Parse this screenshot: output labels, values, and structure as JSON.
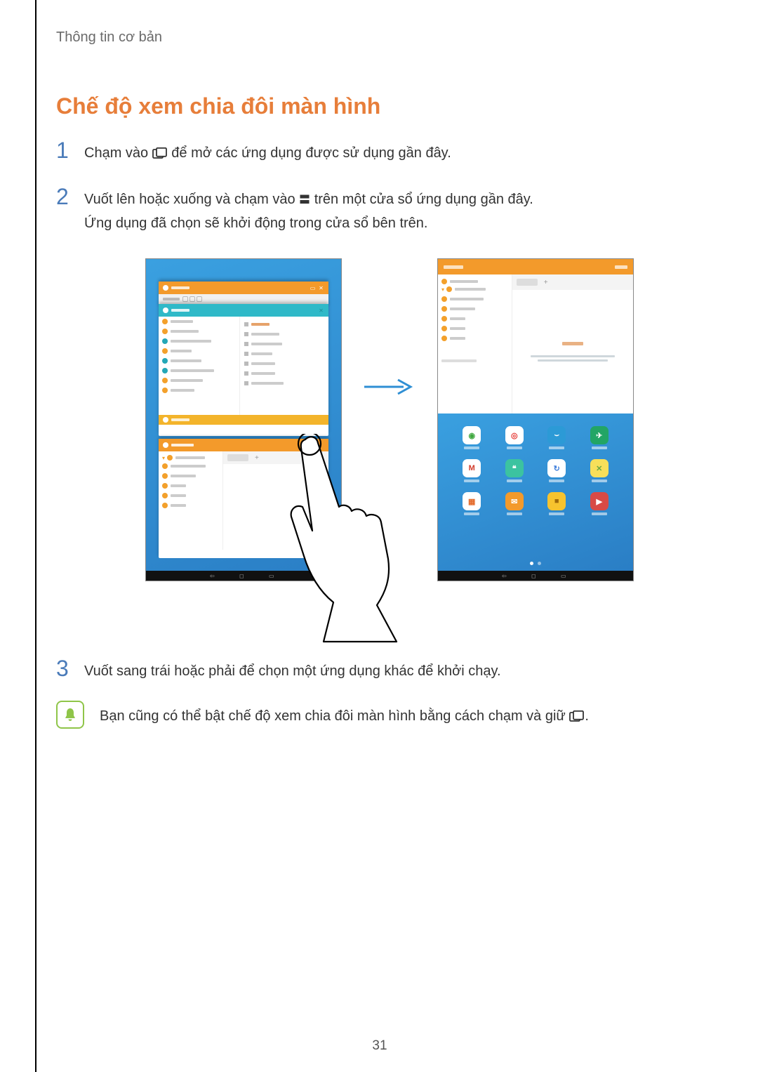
{
  "breadcrumb": "Thông tin cơ bản",
  "heading": "Chế độ xem chia đôi màn hình",
  "steps": {
    "s1": {
      "num": "1",
      "pre": "Chạm vào ",
      "post": " để mở các ứng dụng được sử dụng gần đây."
    },
    "s2": {
      "num": "2",
      "pre": "Vuốt lên hoặc xuống và chạm vào ",
      "post": " trên một cửa sổ ứng dụng gần đây.",
      "line2": "Ứng dụng đã chọn sẽ khởi động trong cửa sổ bên trên."
    },
    "s3": {
      "num": "3",
      "text": "Vuốt sang trái hoặc phải để chọn một ứng dụng khác để khởi chạy."
    }
  },
  "notice": {
    "pre": "Bạn cũng có thể bật chế độ xem chia đôi màn hình bằng cách chạm và giữ ",
    "post": "."
  },
  "page_number": "31",
  "figure": {
    "right_tabs_plus": "+",
    "apps": [
      {
        "bg": "#ffffff",
        "fg": "#40a840",
        "glyph": "◉"
      },
      {
        "bg": "#ffffff",
        "fg": "#e53935",
        "glyph": "◎"
      },
      {
        "bg": "#2c9ad6",
        "fg": "#ffffff",
        "glyph": "⌣"
      },
      {
        "bg": "#22a565",
        "fg": "#ffffff",
        "glyph": "✈"
      },
      {
        "bg": "#ffffff",
        "fg": "#d23b2a",
        "glyph": "M"
      },
      {
        "bg": "#3cc3a0",
        "fg": "#ffffff",
        "glyph": "❝"
      },
      {
        "bg": "#ffffff",
        "fg": "#3d7edb",
        "glyph": "↻"
      },
      {
        "bg": "#f7df5a",
        "fg": "#6aa844",
        "glyph": "✕"
      },
      {
        "bg": "#ffffff",
        "fg": "#e36a2a",
        "glyph": "▦"
      },
      {
        "bg": "#f39a2b",
        "fg": "#ffffff",
        "glyph": "✉"
      },
      {
        "bg": "#f7c32e",
        "fg": "#a06a0a",
        "glyph": "■"
      },
      {
        "bg": "#d84a46",
        "fg": "#ffffff",
        "glyph": "▶"
      }
    ]
  }
}
